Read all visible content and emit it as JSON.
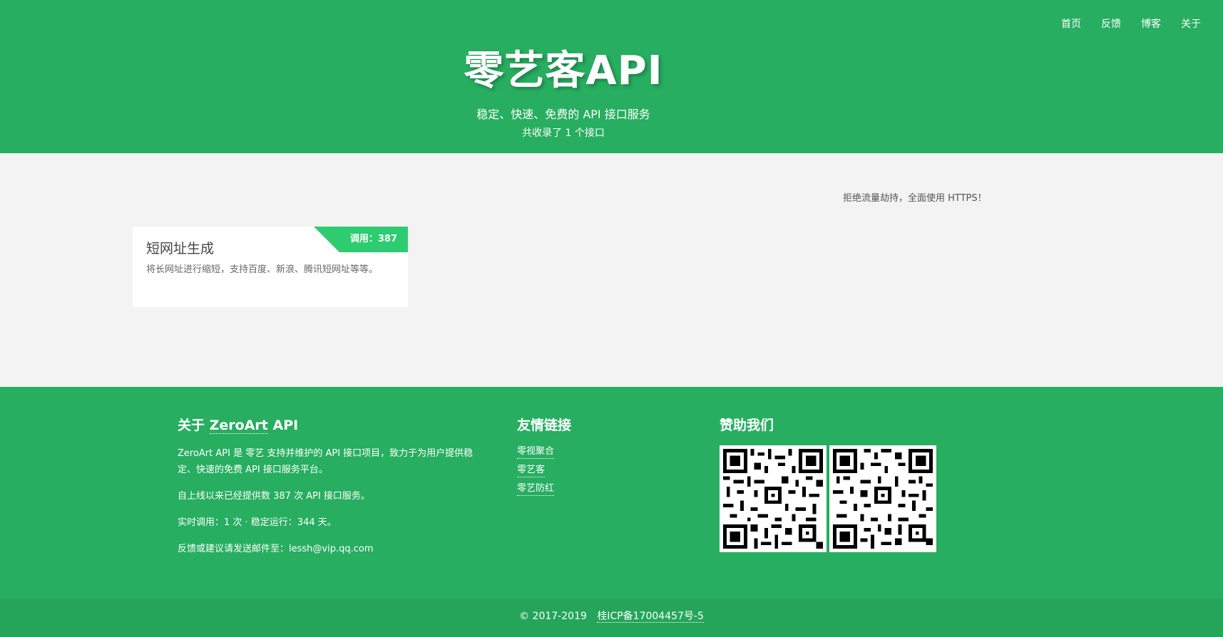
{
  "nav": [
    "首页",
    "反馈",
    "博客",
    "关于"
  ],
  "header": {
    "title": "零艺客API",
    "subtitle": "稳定、快速、免费的 API 接口服务",
    "count": "共收录了 1 个接口"
  },
  "main": {
    "https_note": "拒绝流量劫持，全面使用 HTTPS！",
    "cards": [
      {
        "calls_label": "调用：387",
        "title": "短网址生成",
        "desc": "将长网址进行缩短，支持百度、新浪、腾讯短网址等等。"
      }
    ]
  },
  "footer": {
    "about": {
      "heading_prefix": "关于 ",
      "heading_link": "ZeroArt",
      "heading_suffix": " API",
      "p1": "ZeroArt API 是 零艺 支持并维护的 API 接口项目，致力于为用户提供稳定、快速的免费 API 接口服务平台。",
      "p2": "自上线以来已经提供数 387 次 API 接口服务。",
      "p3": "实时调用：1 次 · 稳定运行：344 天。",
      "p4": "反馈或建议请发送邮件至：lessh@vip.qq.com"
    },
    "links": {
      "heading": "友情链接",
      "items": [
        "零视聚合",
        "零艺客",
        "零艺防红"
      ]
    },
    "sponsor": {
      "heading": "赞助我们"
    }
  },
  "bottom": {
    "copyright": "© 2017-2019",
    "icp": "桂ICP备17004457号-5"
  },
  "colors": {
    "brand_green": "#27ae60",
    "ribbon_green": "#2ecc71",
    "background": "#f3f3f3"
  }
}
